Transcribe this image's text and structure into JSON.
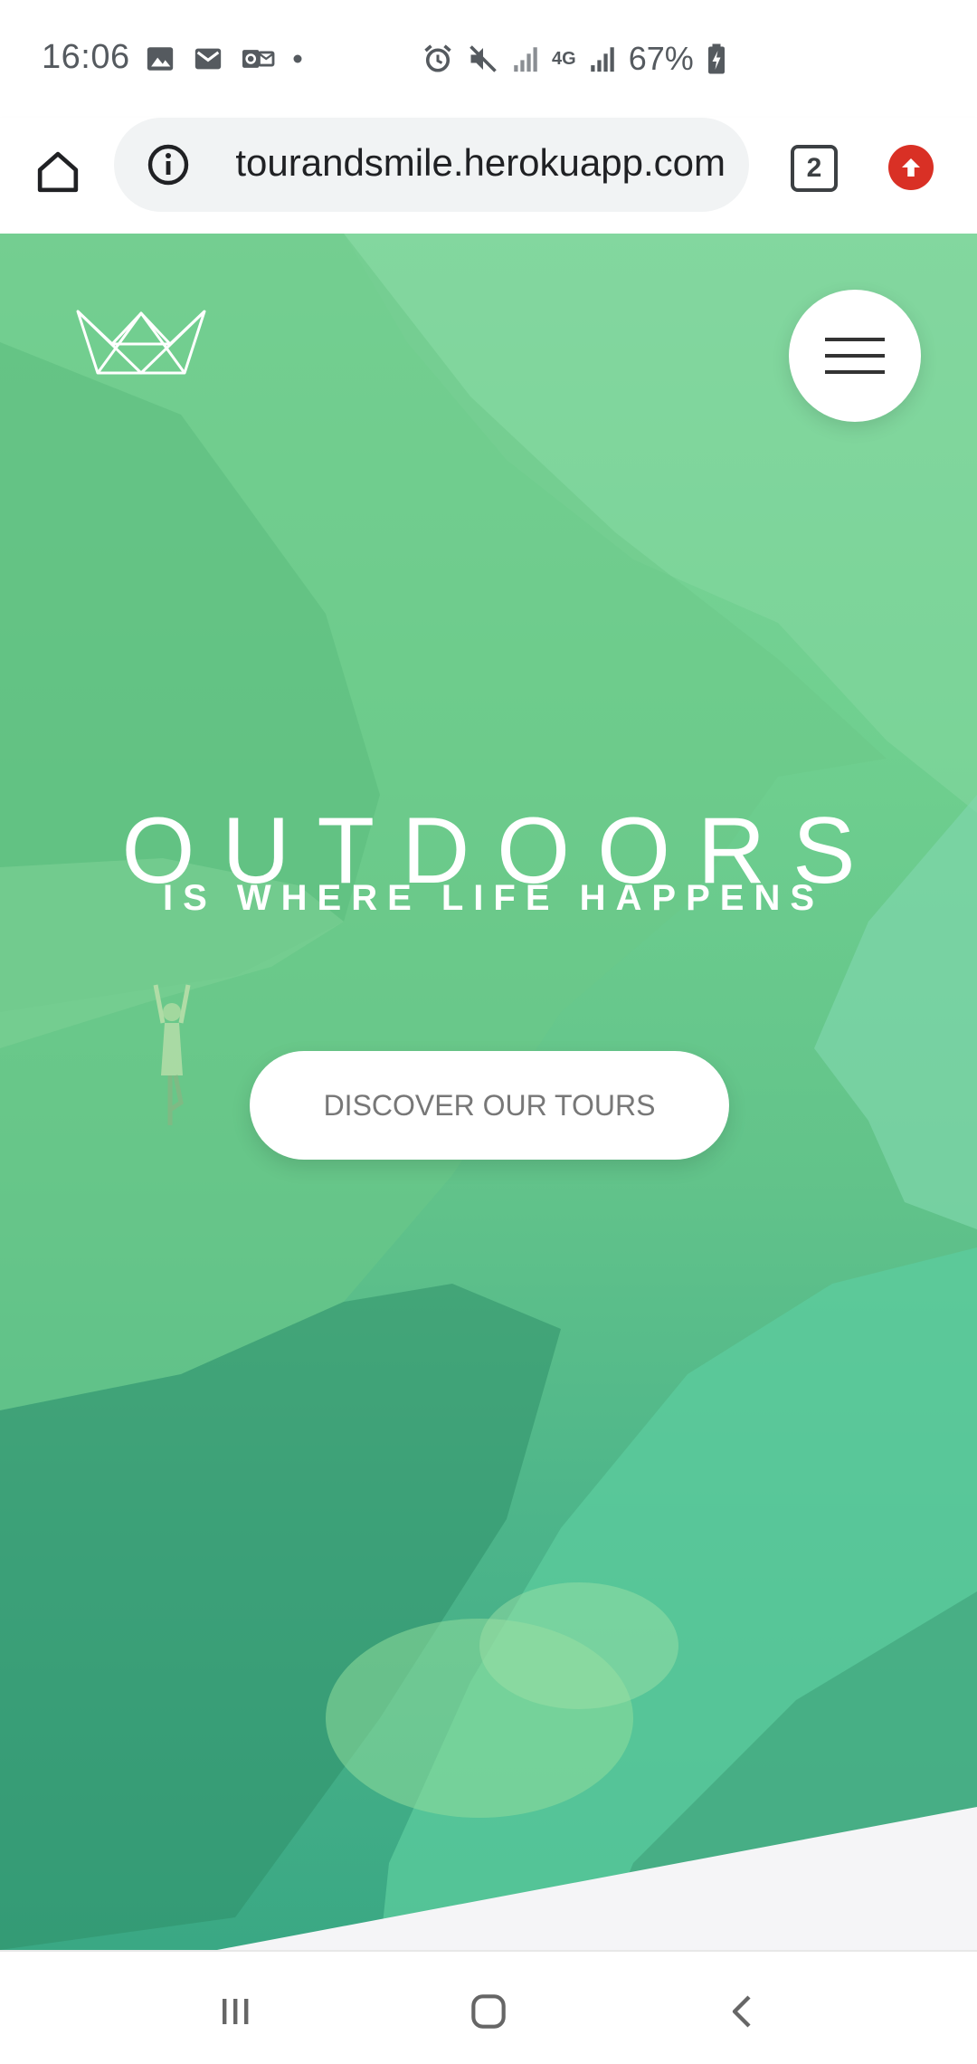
{
  "status_bar": {
    "time": "16:06",
    "network": "4G",
    "battery": "67%",
    "left_icons": [
      "image-icon",
      "gmail-icon",
      "outlook-icon",
      "dot-icon"
    ],
    "right_icons": [
      "alarm-icon",
      "mute-icon",
      "signal-icon",
      "network-4g-icon",
      "signal-icon",
      "battery-icon"
    ]
  },
  "browser": {
    "url": "tourandsmile.herokuapp.com",
    "tab_count": "2",
    "icons": [
      "home-icon",
      "info-icon",
      "tabs-icon",
      "update-icon"
    ]
  },
  "hero": {
    "title": "OUTDOORS",
    "subtitle": "IS WHERE LIFE HAPPENS",
    "cta_label": "DISCOVER OUR TOURS",
    "logo_icon": "crown-logo",
    "menu_icon": "hamburger-menu-icon",
    "colors": {
      "overlay_green": "#7ed59b",
      "deep_green": "#3aa884",
      "section_bg": "#f5f5f7"
    }
  },
  "nav_bar": {
    "icons": [
      "recent-apps-icon",
      "home-button-icon",
      "back-icon"
    ]
  }
}
